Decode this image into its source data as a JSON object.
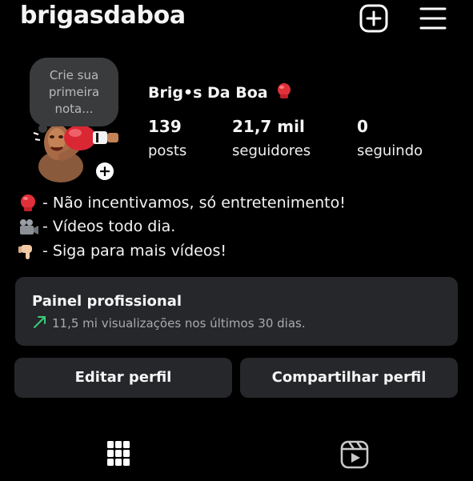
{
  "header": {
    "username": "brigasdaboa",
    "create_icon": "plus-square-icon",
    "menu_icon": "hamburger-menu-icon"
  },
  "note": {
    "line1": "Crie sua",
    "line2": "primeira",
    "line3": "nota..."
  },
  "profile": {
    "display_name": "Brig•s Da Boa",
    "name_emoji": "boxing-glove-icon",
    "avatar": "boxing-avatar-image",
    "add_story_symbol": "+"
  },
  "stats": {
    "posts_count": "139",
    "posts_label": "posts",
    "followers_count": "21,7 mil",
    "followers_label": "seguidores",
    "following_count": "0",
    "following_label": "seguindo"
  },
  "bio": [
    {
      "icon": "boxing-glove-icon",
      "text": "- Não incentivamos, só entretenimento!"
    },
    {
      "icon": "movie-camera-icon",
      "text": "- Vídeos todo dia."
    },
    {
      "icon": "pointing-down-hand-icon",
      "text": "- Siga para mais vídeos!"
    }
  ],
  "professional_panel": {
    "title": "Painel profissional",
    "subtitle": "11,5 mi visualizações nos últimos 30 dias.",
    "trend_icon": "trend-up-arrow-icon",
    "trend_color": "#3ecb7a"
  },
  "actions": {
    "edit_profile": "Editar perfil",
    "share_profile": "Compartilhar perfil"
  },
  "tabs": {
    "grid_icon": "grid-icon",
    "reels_icon": "reels-icon"
  },
  "colors": {
    "background": "#000000",
    "panel": "#25272a",
    "note_bubble": "#3a3b3d",
    "glove_red": "#e0303a"
  }
}
